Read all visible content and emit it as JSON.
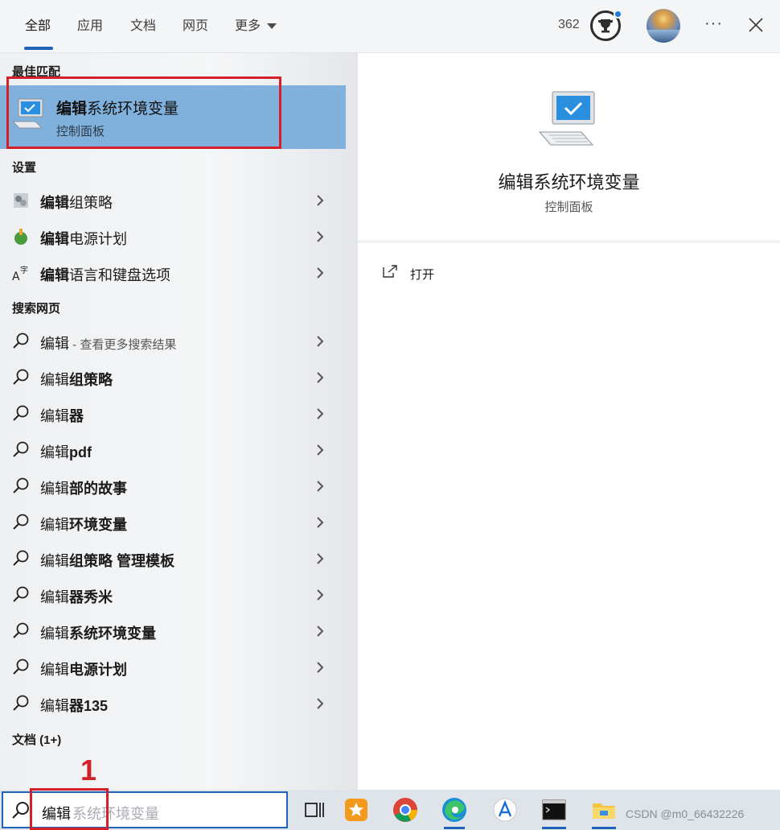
{
  "tabs": [
    {
      "label": "全部",
      "active": true
    },
    {
      "label": "应用"
    },
    {
      "label": "文档"
    },
    {
      "label": "网页"
    },
    {
      "label": "更多"
    }
  ],
  "header": {
    "points": "362",
    "trophy_icon": "trophy-icon",
    "more_icon": "ellipsis-icon",
    "close_icon": "close-icon"
  },
  "best_match": {
    "section": "最佳匹配",
    "title_bold": "编辑",
    "title_rest": "系统环境变量",
    "subtitle": "控制面板",
    "icon": "computer-settings-icon"
  },
  "settings": {
    "section": "设置",
    "items": [
      {
        "bold": "编辑",
        "rest": "组策略",
        "icon": "group-policy-icon"
      },
      {
        "bold": "编辑",
        "rest": "电源计划",
        "icon": "power-plan-icon"
      },
      {
        "bold": "编辑",
        "rest": "语言和键盘选项",
        "icon": "language-icon"
      }
    ]
  },
  "web": {
    "section": "搜索网页",
    "items": [
      {
        "plain": "编辑",
        "bold": "",
        "hint": " - 查看更多搜索结果"
      },
      {
        "plain": "编辑",
        "bold": "组策略"
      },
      {
        "plain": "编辑",
        "bold": "器"
      },
      {
        "plain": "编辑",
        "bold": "pdf"
      },
      {
        "plain": "编辑",
        "bold": "部的故事"
      },
      {
        "plain": "编辑",
        "bold": "环境变量"
      },
      {
        "plain": "编辑",
        "bold": "组策略 管理模板"
      },
      {
        "plain": "编辑",
        "bold": "器秀米"
      },
      {
        "plain": "编辑",
        "bold": "系统环境变量"
      },
      {
        "plain": "编辑",
        "bold": "电源计划"
      },
      {
        "plain": "编辑",
        "bold": "器135"
      }
    ]
  },
  "documents": {
    "section": "文档 (1+)"
  },
  "preview": {
    "title": "编辑系统环境变量",
    "subtitle": "控制面板",
    "action_open": "打开"
  },
  "taskbar": {
    "search_typed": "编辑",
    "search_ghost": "系统环境变量",
    "apps": [
      "task-view-icon",
      "favorites-star-icon",
      "chrome-icon",
      "edge-icon",
      "app-store-icon",
      "terminal-icon",
      "file-explorer-icon"
    ],
    "watermark": "CSDN @m0_66432226"
  },
  "annotation": {
    "step": "1",
    "color": "#d42028"
  },
  "colors": {
    "accent": "#1f63b8",
    "highlight": "#7fb1dc"
  }
}
